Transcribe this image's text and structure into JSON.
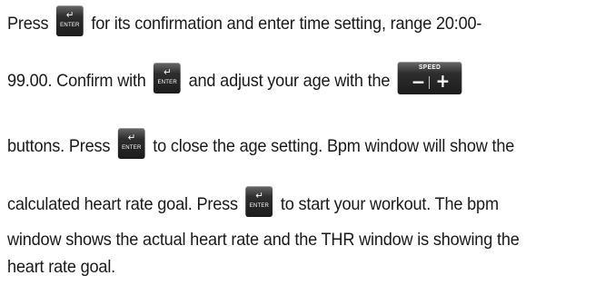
{
  "enter_button": {
    "arrow_symbol": "↵",
    "label": "ENTER"
  },
  "speed_button": {
    "label": "SPEED",
    "minus": "−",
    "plus": "+"
  },
  "lines": {
    "l1_a": "Press",
    "l1_b": "for its confirmation and enter time setting, range 20:00-",
    "l2_a": "99.00. Confirm with",
    "l2_b": "and adjust your age with the",
    "l3_a": "buttons. Press",
    "l3_b": "to close the age setting. Bpm window will show the",
    "l4_a": "calculated heart rate goal. Press",
    "l4_b": "to start your workout. The bpm",
    "l5": "window shows the actual heart rate and the THR window is showing the",
    "l6": "heart rate goal."
  }
}
